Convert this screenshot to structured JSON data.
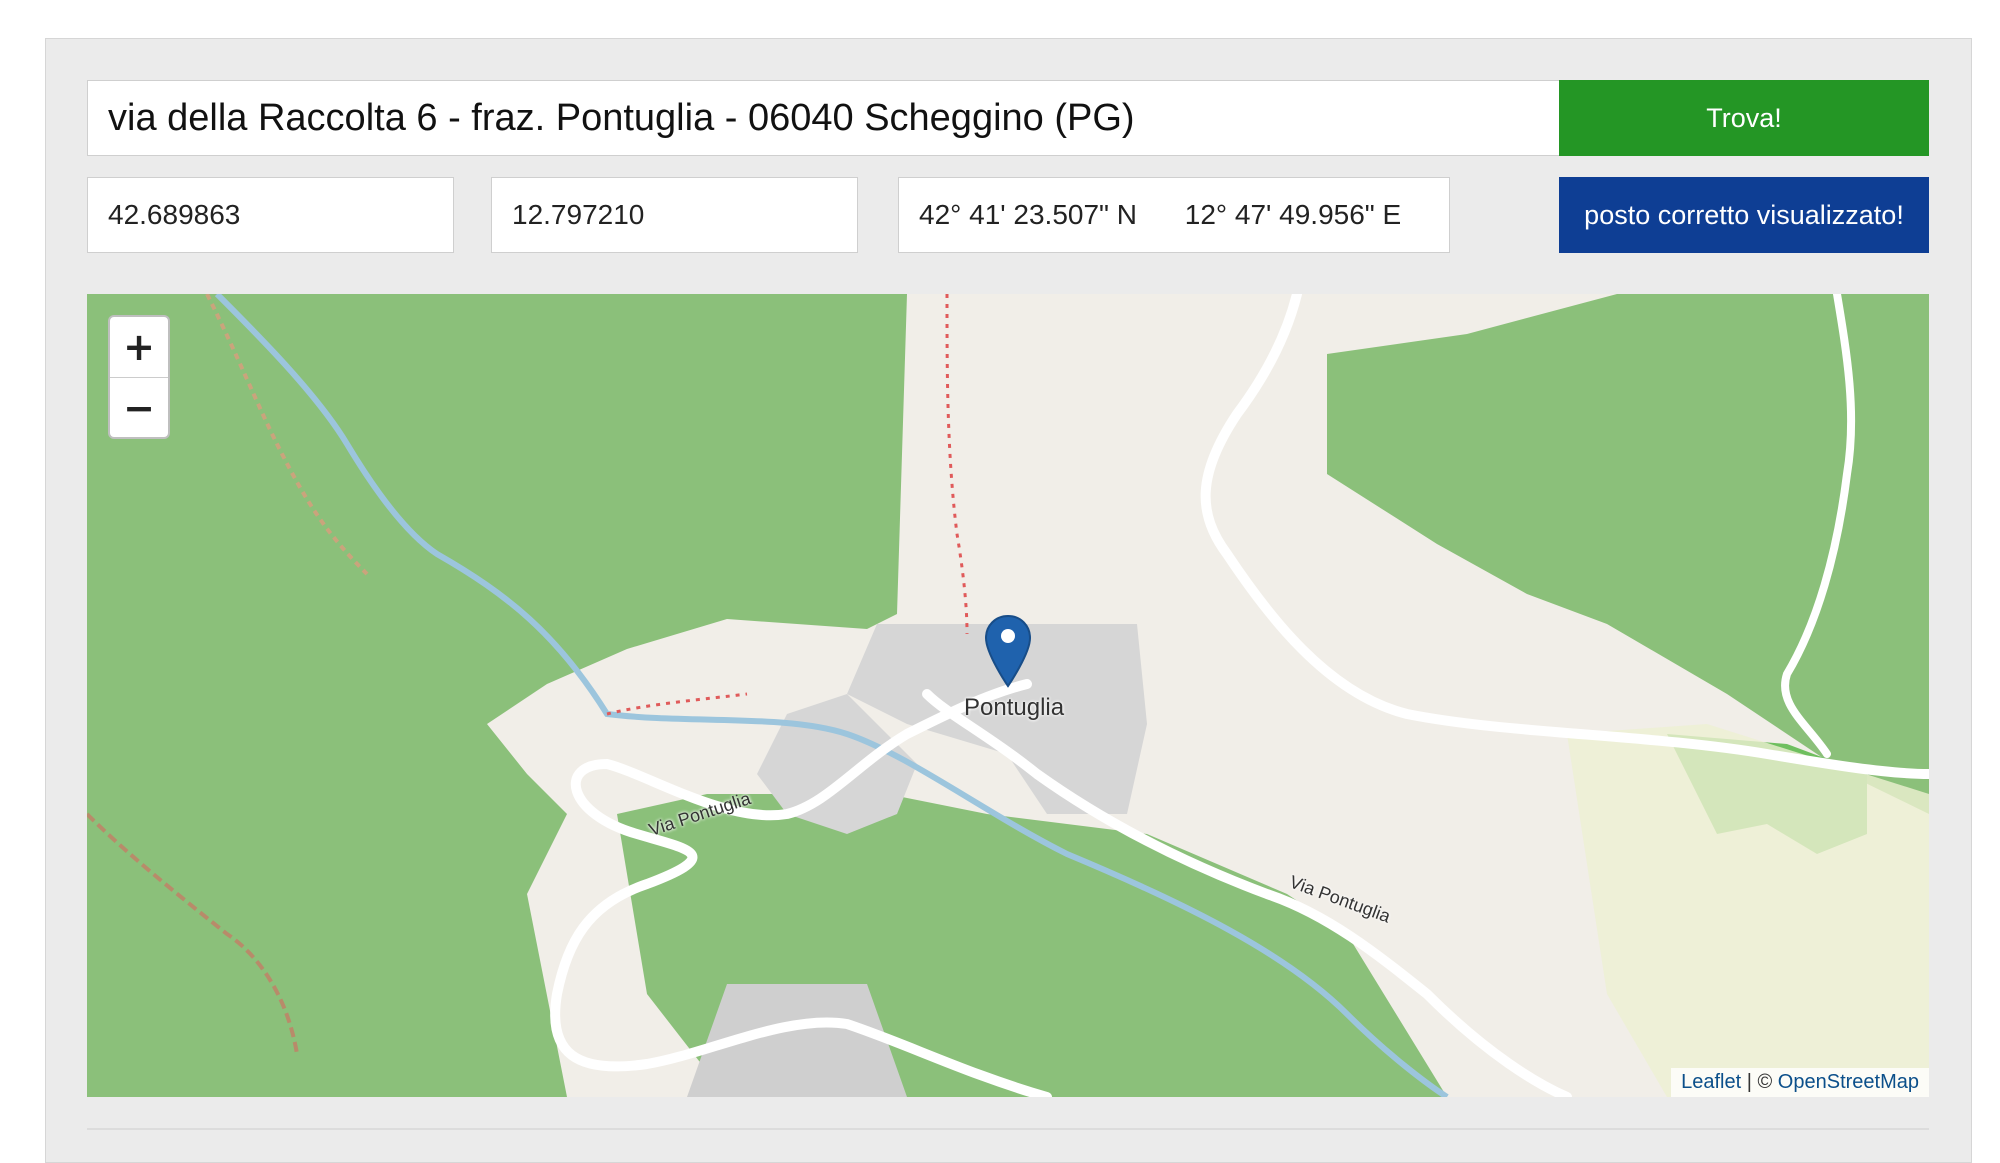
{
  "search": {
    "address_value": "via della Raccolta 6 - fraz. Pontuglia - 06040 Scheggino (PG)",
    "find_button": "Trova!"
  },
  "coords": {
    "latitude": "42.689863",
    "longitude": "12.797210",
    "dms_lat": "42° 41' 23.507\" N",
    "dms_lon": "12° 47' 49.956\" E",
    "confirm_button": "posto corretto visualizzato!"
  },
  "map": {
    "zoom_in": "+",
    "zoom_out": "−",
    "place_label": "Pontuglia",
    "street_label_1": "Via Pontuglia",
    "street_label_2": "Via Pontuglia",
    "attribution_leaflet": "Leaflet",
    "attribution_sep": " | © ",
    "attribution_osm": "OpenStreetMap",
    "marker_icon": "map-marker-icon",
    "colors": {
      "forest": "#8bc07a",
      "land": "#f1eee8",
      "residential": "#d9d9d9",
      "river": "#a8cde0",
      "button_green": "#249625",
      "button_blue": "#0e3e94"
    }
  }
}
